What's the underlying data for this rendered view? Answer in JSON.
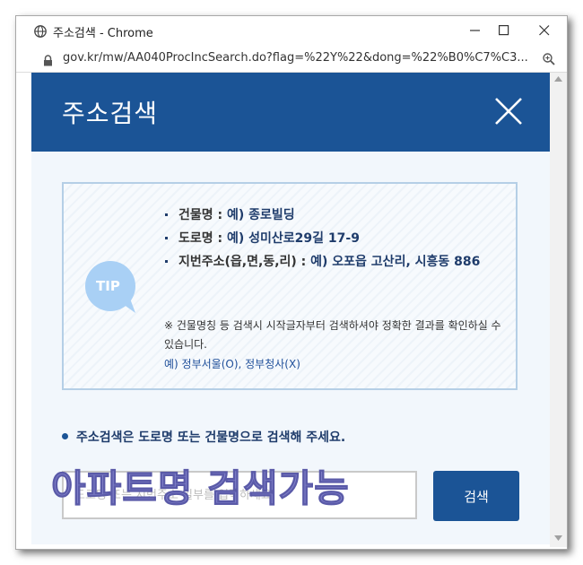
{
  "window": {
    "title": "주소검색 - Chrome",
    "url": "gov.kr/mw/AA040ProcIncSearch.do?flag=%22Y%22&dong=%22%B0%C7%C3..."
  },
  "dialog": {
    "title": "주소검색",
    "tip_badge": "TIP",
    "tips": [
      {
        "key": "건물명 :",
        "value": " 예) 종로빌딩"
      },
      {
        "key": "도로명 :",
        "value": " 예) 성미산로29길 17-9"
      },
      {
        "key": "지번주소(읍,면,동,리) :",
        "value": " 예) 오포읍 고산리, 시흥동 886"
      }
    ],
    "note": "※ 건물명칭 등 검색시 시작글자부터 검색하셔야 정확한 결과를 확인하실 수 있습니다.",
    "note_example": "예) 정부서울(O), 정부청사(X)",
    "guide": "주소검색은 도로명 또는 건물명으로 검색해 주세요.",
    "search_placeholder": "도로명 또는 지번주소 일부를 입력하세요.",
    "search_button": "검색",
    "overlay_text": "아파트명 검색가능"
  },
  "colors": {
    "header": "#1b5496",
    "content_bg": "#f2f7fc",
    "tip_bubble": "#a9d0f5",
    "overlay": "#7f7fc8"
  },
  "icons": [
    "globe-icon",
    "lock-icon",
    "zoom-icon",
    "minimize-icon",
    "maximize-icon",
    "close-icon",
    "tip-bubble-icon"
  ]
}
